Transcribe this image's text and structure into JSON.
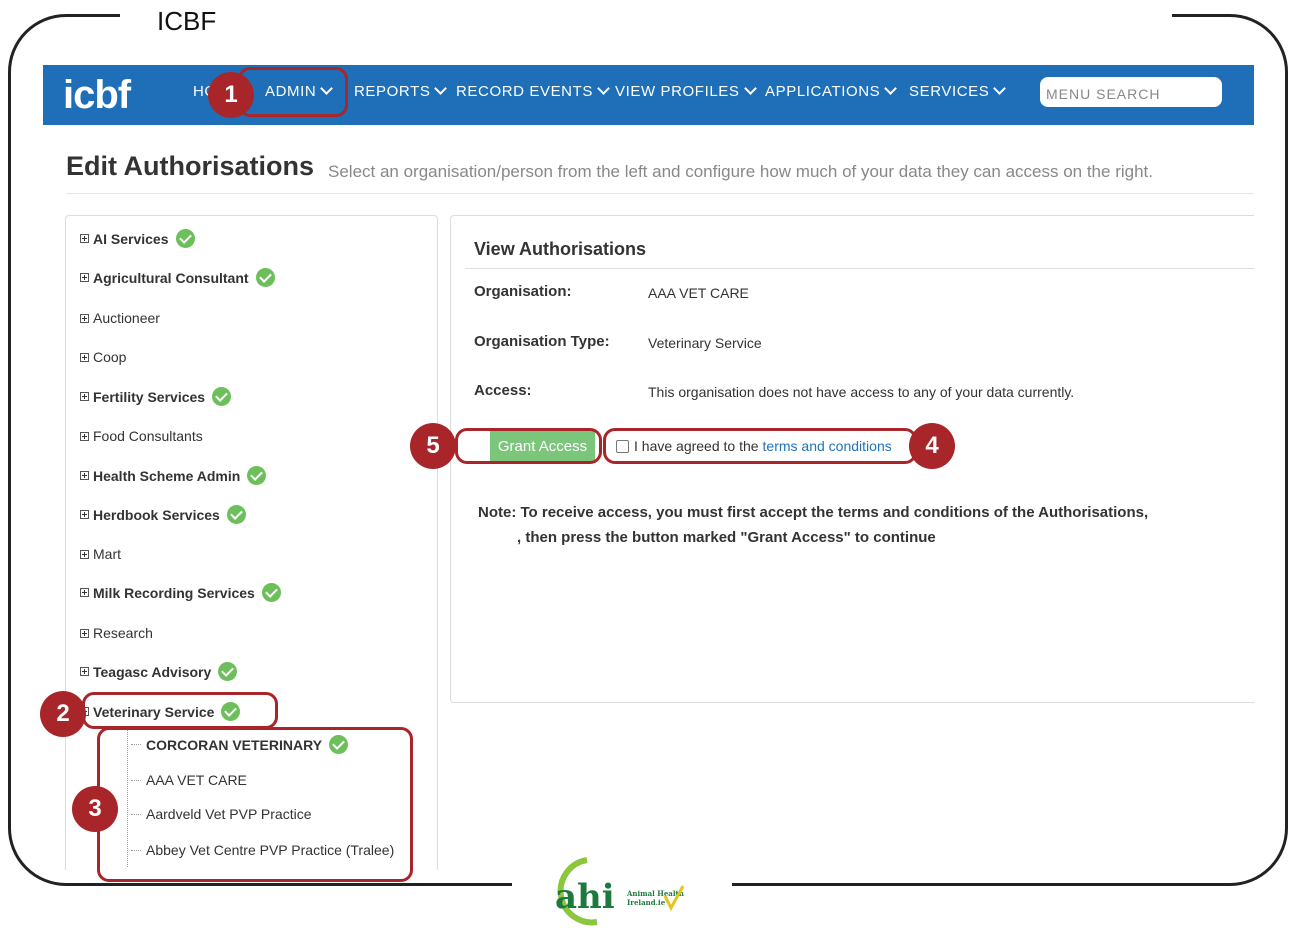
{
  "caption": "ICBF",
  "navbar": {
    "logo": "icbf",
    "items": [
      {
        "label": "HO"
      },
      {
        "label": "ADMIN"
      },
      {
        "label": "REPORTS"
      },
      {
        "label": "RECORD EVENTS"
      },
      {
        "label": "VIEW PROFILES"
      },
      {
        "label": "APPLICATIONS"
      },
      {
        "label": "SERVICES"
      }
    ],
    "search_placeholder": "MENU SEARCH"
  },
  "page": {
    "title": "Edit Authorisations",
    "subtitle": "Select an organisation/person from the left and configure how much of your data they can access on the right."
  },
  "tree": {
    "items": [
      {
        "label": "AI Services",
        "bold": true,
        "verified": true
      },
      {
        "label": "Agricultural Consultant",
        "bold": true,
        "verified": true
      },
      {
        "label": "Auctioneer",
        "bold": false,
        "verified": false
      },
      {
        "label": "Coop",
        "bold": false,
        "verified": false
      },
      {
        "label": "Fertility Services",
        "bold": true,
        "verified": true
      },
      {
        "label": "Food Consultants",
        "bold": false,
        "verified": false
      },
      {
        "label": "Health Scheme Admin",
        "bold": true,
        "verified": true
      },
      {
        "label": "Herdbook Services",
        "bold": true,
        "verified": true
      },
      {
        "label": "Mart",
        "bold": false,
        "verified": false
      },
      {
        "label": "Milk Recording Services",
        "bold": true,
        "verified": true
      },
      {
        "label": "Research",
        "bold": false,
        "verified": false
      },
      {
        "label": "Teagasc Advisory",
        "bold": true,
        "verified": true
      },
      {
        "label": "Veterinary Service",
        "bold": true,
        "verified": true,
        "expanded": true
      }
    ],
    "children": [
      {
        "label": "CORCORAN VETERINARY",
        "bold": true,
        "verified": true
      },
      {
        "label": "AAA VET CARE",
        "bold": false,
        "verified": false
      },
      {
        "label": "Aardveld Vet PVP Practice",
        "bold": false,
        "verified": false
      },
      {
        "label": "Abbey Vet Centre PVP Practice (Tralee)",
        "bold": false,
        "verified": false
      }
    ]
  },
  "auth": {
    "title": "View Authorisations",
    "organisation_label": "Organisation:",
    "organisation_value": "AAA VET CARE",
    "type_label": "Organisation Type:",
    "type_value": "Veterinary Service",
    "access_label": "Access:",
    "access_value": "This organisation does not have access to any of your data currently.",
    "grant_button": "Grant Access",
    "terms_text": "I have agreed to the",
    "terms_link": "terms and conditions",
    "note_line1": "Note: To receive access, you must first accept the terms and conditions of the Authorisations,",
    "note_line2": ", then press the button marked \"Grant Access\" to continue"
  },
  "annotations": {
    "b1": "1",
    "b2": "2",
    "b3": "3",
    "b4": "4",
    "b5": "5"
  },
  "footer_logo": {
    "mark": "ahi",
    "line1": "Animal Health",
    "line2": "Ireland.ie"
  },
  "colors": {
    "navbar": "#1e6fb8",
    "annotation": "#a8262a",
    "verified": "#6cbf5a",
    "grant_button": "#7cc67c",
    "link": "#1e73be"
  }
}
